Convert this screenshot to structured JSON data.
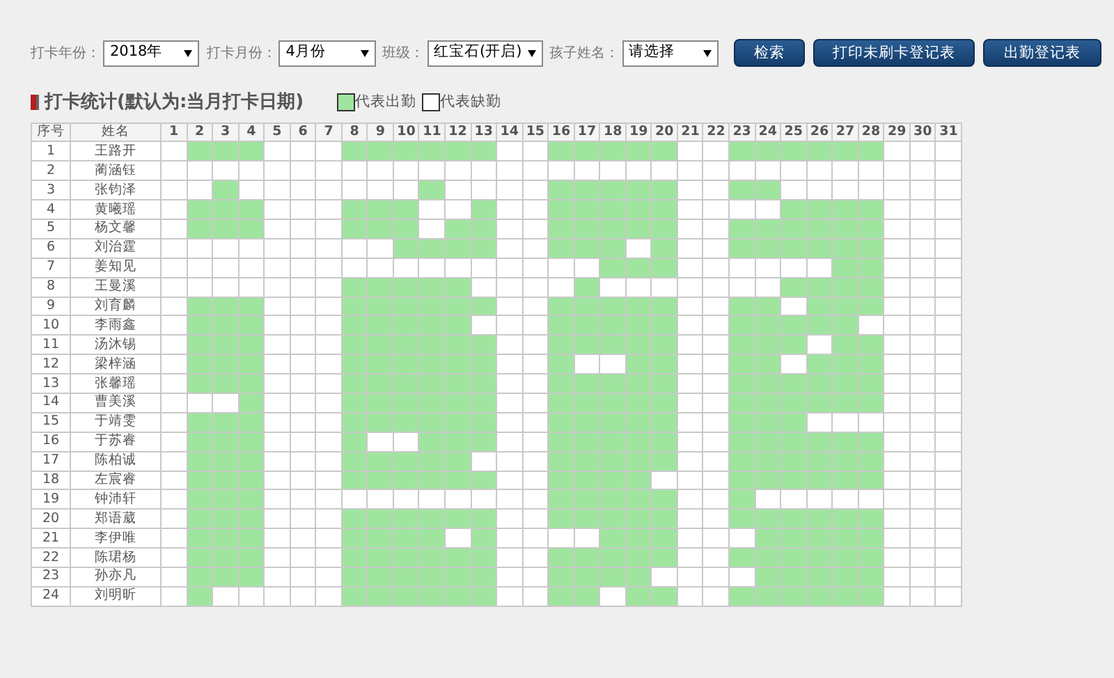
{
  "filters": [
    {
      "label": "打卡年份：",
      "value": "2018年"
    },
    {
      "label": "打卡月份：",
      "value": "4月份"
    },
    {
      "label": "班级：",
      "value": "红宝石(开启)"
    },
    {
      "label": "孩子姓名：",
      "value": "请选择"
    }
  ],
  "buttons": [
    "检索",
    "打印未刷卡登记表",
    "出勤登记表"
  ],
  "section_title": "打卡统计(默认为:当月打卡日期)",
  "legend": [
    {
      "label": "代表出勤",
      "present": true
    },
    {
      "label": "代表缺勤",
      "present": false
    }
  ],
  "table": {
    "columns": [
      "序号",
      "姓名",
      "1",
      "2",
      "3",
      "4",
      "5",
      "6",
      "7",
      "8",
      "9",
      "10",
      "11",
      "12",
      "13",
      "14",
      "15",
      "16",
      "17",
      "18",
      "19",
      "20",
      "21",
      "22",
      "23",
      "24",
      "25",
      "26",
      "27",
      "28",
      "29",
      "30",
      "31"
    ],
    "rows": [
      {
        "no": "1",
        "name": "王路开",
        "days": [
          false,
          true,
          true,
          true,
          false,
          false,
          false,
          true,
          true,
          true,
          true,
          true,
          true,
          false,
          false,
          true,
          true,
          true,
          true,
          true,
          false,
          false,
          true,
          true,
          true,
          true,
          true,
          true,
          false,
          false,
          false
        ]
      },
      {
        "no": "2",
        "name": "蔺涵钰",
        "days": [
          false,
          false,
          false,
          false,
          false,
          false,
          false,
          false,
          false,
          false,
          false,
          false,
          false,
          false,
          false,
          false,
          false,
          false,
          false,
          false,
          false,
          false,
          false,
          false,
          false,
          false,
          false,
          false,
          false,
          false,
          false
        ]
      },
      {
        "no": "3",
        "name": "张钧泽",
        "days": [
          false,
          false,
          true,
          false,
          false,
          false,
          false,
          false,
          false,
          false,
          true,
          false,
          false,
          false,
          false,
          true,
          true,
          true,
          true,
          true,
          false,
          false,
          true,
          true,
          false,
          false,
          false,
          false,
          false,
          false,
          false
        ]
      },
      {
        "no": "4",
        "name": "黄曦瑶",
        "days": [
          false,
          true,
          true,
          true,
          false,
          false,
          false,
          true,
          true,
          true,
          false,
          false,
          true,
          false,
          false,
          true,
          true,
          true,
          true,
          true,
          false,
          false,
          false,
          false,
          true,
          true,
          true,
          true,
          false,
          false,
          false
        ]
      },
      {
        "no": "5",
        "name": "杨文馨",
        "days": [
          false,
          true,
          true,
          true,
          false,
          false,
          false,
          true,
          true,
          true,
          false,
          true,
          true,
          false,
          false,
          true,
          true,
          true,
          true,
          true,
          false,
          false,
          true,
          true,
          true,
          true,
          true,
          true,
          false,
          false,
          false
        ]
      },
      {
        "no": "6",
        "name": "刘治霆",
        "days": [
          false,
          false,
          false,
          false,
          false,
          false,
          false,
          false,
          false,
          true,
          true,
          true,
          true,
          false,
          false,
          true,
          true,
          true,
          false,
          true,
          false,
          false,
          true,
          true,
          true,
          true,
          true,
          true,
          false,
          false,
          false
        ]
      },
      {
        "no": "7",
        "name": "姜知见",
        "days": [
          false,
          false,
          false,
          false,
          false,
          false,
          false,
          false,
          false,
          false,
          false,
          false,
          false,
          false,
          false,
          false,
          false,
          true,
          true,
          true,
          false,
          false,
          false,
          false,
          false,
          false,
          true,
          true,
          false,
          false,
          false
        ]
      },
      {
        "no": "8",
        "name": "王曼溪",
        "days": [
          false,
          false,
          false,
          false,
          false,
          false,
          false,
          true,
          true,
          true,
          true,
          true,
          false,
          false,
          false,
          false,
          true,
          false,
          false,
          false,
          false,
          false,
          false,
          false,
          true,
          true,
          true,
          true,
          false,
          false,
          false
        ]
      },
      {
        "no": "9",
        "name": "刘育麟",
        "days": [
          false,
          true,
          true,
          true,
          false,
          false,
          false,
          true,
          true,
          true,
          true,
          true,
          true,
          false,
          false,
          true,
          true,
          true,
          true,
          true,
          false,
          false,
          true,
          true,
          false,
          true,
          true,
          true,
          false,
          false,
          false
        ]
      },
      {
        "no": "10",
        "name": "李雨鑫",
        "days": [
          false,
          true,
          true,
          true,
          false,
          false,
          false,
          true,
          true,
          true,
          true,
          true,
          false,
          false,
          false,
          true,
          true,
          true,
          true,
          true,
          false,
          false,
          true,
          true,
          true,
          true,
          true,
          false,
          false,
          false,
          false
        ]
      },
      {
        "no": "11",
        "name": "汤沐锡",
        "days": [
          false,
          true,
          true,
          true,
          false,
          false,
          false,
          true,
          true,
          true,
          true,
          true,
          true,
          false,
          false,
          true,
          true,
          true,
          true,
          true,
          false,
          false,
          true,
          true,
          true,
          false,
          true,
          true,
          false,
          false,
          false
        ]
      },
      {
        "no": "12",
        "name": "梁梓涵",
        "days": [
          false,
          true,
          true,
          true,
          false,
          false,
          false,
          true,
          true,
          true,
          true,
          true,
          true,
          false,
          false,
          true,
          false,
          false,
          true,
          true,
          false,
          false,
          true,
          true,
          false,
          true,
          true,
          true,
          false,
          false,
          false
        ]
      },
      {
        "no": "13",
        "name": "张馨瑶",
        "days": [
          false,
          true,
          true,
          true,
          false,
          false,
          false,
          true,
          true,
          true,
          true,
          true,
          true,
          false,
          false,
          true,
          true,
          true,
          true,
          true,
          false,
          false,
          true,
          true,
          true,
          true,
          true,
          true,
          false,
          false,
          false
        ]
      },
      {
        "no": "14",
        "name": "曹美溪",
        "days": [
          false,
          false,
          false,
          true,
          false,
          false,
          false,
          true,
          true,
          true,
          true,
          true,
          true,
          false,
          false,
          true,
          true,
          true,
          true,
          true,
          false,
          false,
          true,
          true,
          true,
          true,
          true,
          true,
          false,
          false,
          false
        ]
      },
      {
        "no": "15",
        "name": "于靖雯",
        "days": [
          false,
          true,
          true,
          true,
          false,
          false,
          false,
          true,
          true,
          true,
          true,
          true,
          true,
          false,
          false,
          true,
          true,
          true,
          true,
          true,
          false,
          false,
          true,
          true,
          true,
          false,
          false,
          false,
          false,
          false,
          false
        ]
      },
      {
        "no": "16",
        "name": "于苏睿",
        "days": [
          false,
          true,
          true,
          true,
          false,
          false,
          false,
          true,
          false,
          false,
          true,
          true,
          true,
          false,
          false,
          true,
          true,
          true,
          true,
          true,
          false,
          false,
          true,
          true,
          true,
          true,
          true,
          true,
          false,
          false,
          false
        ]
      },
      {
        "no": "17",
        "name": "陈柏诚",
        "days": [
          false,
          true,
          true,
          true,
          false,
          false,
          false,
          true,
          true,
          true,
          true,
          true,
          false,
          false,
          false,
          true,
          true,
          true,
          true,
          true,
          false,
          false,
          true,
          true,
          true,
          true,
          true,
          true,
          false,
          false,
          false
        ]
      },
      {
        "no": "18",
        "name": "左宸睿",
        "days": [
          false,
          true,
          true,
          true,
          false,
          false,
          false,
          true,
          true,
          true,
          true,
          true,
          true,
          false,
          false,
          true,
          true,
          true,
          true,
          false,
          false,
          false,
          true,
          true,
          true,
          true,
          true,
          true,
          false,
          false,
          false
        ]
      },
      {
        "no": "19",
        "name": "钟沛轩",
        "days": [
          false,
          true,
          true,
          true,
          false,
          false,
          false,
          false,
          false,
          false,
          false,
          false,
          false,
          false,
          false,
          true,
          true,
          true,
          true,
          true,
          false,
          false,
          true,
          false,
          false,
          false,
          false,
          false,
          false,
          false,
          false
        ]
      },
      {
        "no": "20",
        "name": "郑语葳",
        "days": [
          false,
          true,
          true,
          true,
          false,
          false,
          false,
          true,
          true,
          true,
          true,
          true,
          true,
          false,
          false,
          true,
          true,
          true,
          true,
          true,
          false,
          false,
          true,
          true,
          true,
          true,
          true,
          true,
          false,
          false,
          false
        ]
      },
      {
        "no": "21",
        "name": "李伊唯",
        "days": [
          false,
          true,
          true,
          true,
          false,
          false,
          false,
          true,
          true,
          true,
          true,
          false,
          true,
          false,
          false,
          false,
          false,
          true,
          true,
          true,
          false,
          false,
          false,
          true,
          true,
          true,
          true,
          true,
          false,
          false,
          false
        ]
      },
      {
        "no": "22",
        "name": "陈珺杨",
        "days": [
          false,
          true,
          true,
          true,
          false,
          false,
          false,
          true,
          true,
          true,
          true,
          true,
          true,
          false,
          false,
          true,
          true,
          true,
          true,
          true,
          false,
          false,
          true,
          true,
          true,
          true,
          true,
          true,
          false,
          false,
          false
        ]
      },
      {
        "no": "23",
        "name": "孙亦凡",
        "days": [
          false,
          true,
          true,
          true,
          false,
          false,
          false,
          true,
          true,
          true,
          true,
          true,
          true,
          false,
          false,
          true,
          true,
          true,
          true,
          false,
          false,
          false,
          false,
          true,
          true,
          true,
          true,
          true,
          false,
          false,
          false
        ]
      },
      {
        "no": "24",
        "name": "刘明昕",
        "days": [
          false,
          true,
          false,
          false,
          false,
          false,
          false,
          true,
          true,
          true,
          true,
          true,
          true,
          false,
          false,
          true,
          true,
          false,
          true,
          true,
          false,
          false,
          true,
          true,
          true,
          true,
          true,
          true,
          false,
          false,
          false
        ]
      }
    ]
  }
}
